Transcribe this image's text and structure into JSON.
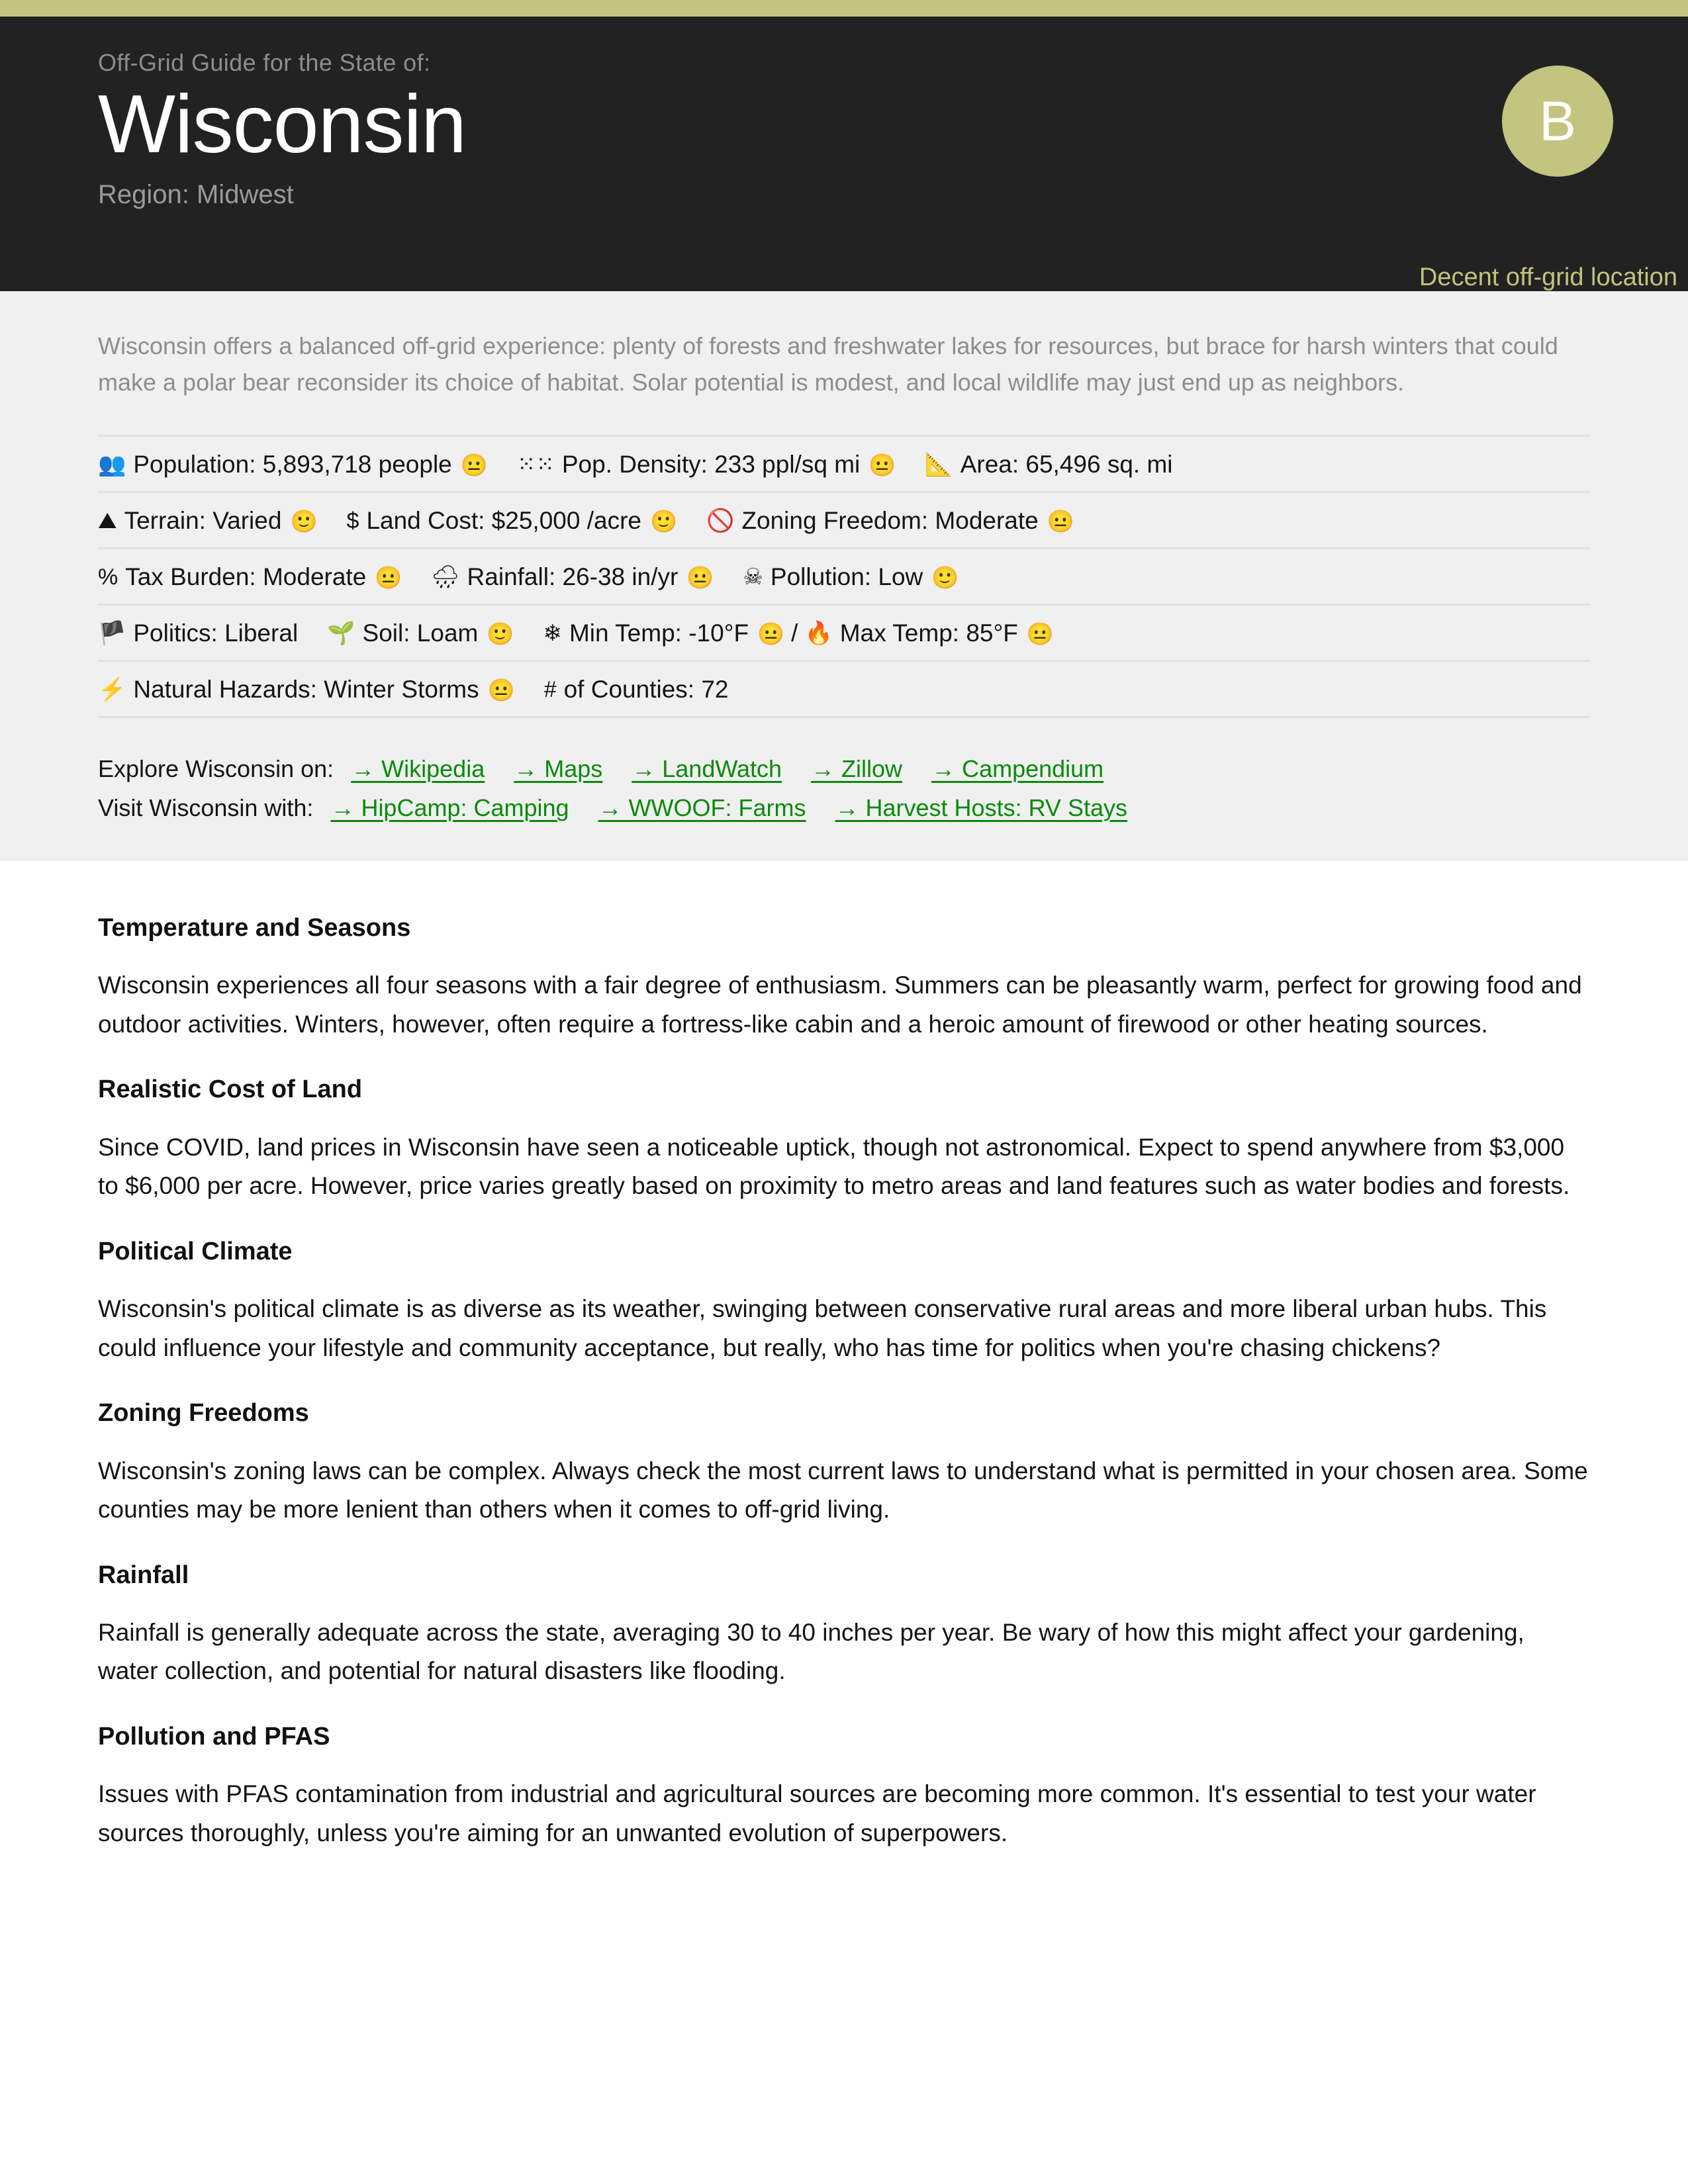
{
  "theme": {
    "accent": "#c2c47f",
    "header_bg": "#222222",
    "panel_bg": "#f0f0f0",
    "link_color": "#0a8a0a",
    "face_neutral_color": "#d9b118",
    "face_happy_color": "#4e9a4e"
  },
  "header": {
    "eyebrow": "Off-Grid Guide for the State of:",
    "title": "Wisconsin",
    "region": "Region: Midwest",
    "grade": "B",
    "grade_caption": "Decent off-grid location"
  },
  "summary": {
    "intro": "Wisconsin offers a balanced off-grid experience: plenty of forests and freshwater lakes for resources, but brace for harsh winters that could make a polar bear reconsider its choice of habitat. Solar potential is modest, and local wildlife may just end up as neighbors."
  },
  "stats": {
    "rows": [
      [
        {
          "icon": "people-icon",
          "glyph": "👥",
          "label": "Population: 5,893,718 people",
          "face": "neutral"
        },
        {
          "icon": "density-dots-icon",
          "glyph": "⁙⁙",
          "label": "Pop. Density: 233 ppl/sq mi",
          "face": "neutral"
        },
        {
          "icon": "ruler-icon",
          "glyph": "📐",
          "label": "Area: 65,496 sq. mi",
          "face": ""
        }
      ],
      [
        {
          "icon": "mountain-icon",
          "glyph": "⛰",
          "label": "Terrain: Varied",
          "face": "happy"
        },
        {
          "icon": "dollar-icon",
          "glyph": "$",
          "label": "Land Cost: $25,000 /acre",
          "face": "happy"
        },
        {
          "icon": "no-entry-icon",
          "glyph": "🚫",
          "label": "Zoning Freedom: Moderate",
          "face": "neutral"
        }
      ],
      [
        {
          "icon": "percent-icon",
          "glyph": "%",
          "label": "Tax Burden: Moderate",
          "face": "neutral"
        },
        {
          "icon": "rain-cloud-icon",
          "glyph": "🌧",
          "label": "Rainfall: 26-38 in/yr",
          "face": "neutral"
        },
        {
          "icon": "skull-crossbones-icon",
          "glyph": "☠",
          "label": "Pollution: Low",
          "face": "happy"
        }
      ],
      [
        {
          "icon": "flag-icon",
          "glyph": "🏴",
          "label": "Politics: Liberal",
          "face": ""
        },
        {
          "icon": "seedling-icon",
          "glyph": "🌱",
          "label": "Soil: Loam",
          "face": "happy"
        },
        {
          "icon": "snowflake-icon",
          "glyph": "❄",
          "label": "Min Temp: -10°F",
          "face": "neutral",
          "separator": "/"
        },
        {
          "icon": "flame-icon",
          "glyph": "🔥",
          "label": "Max Temp: 85°F",
          "face": "neutral"
        }
      ],
      [
        {
          "icon": "lightning-bolt-icon",
          "glyph": "⚡",
          "label": "Natural Hazards: Winter Storms",
          "face": "neutral"
        },
        {
          "icon": "hash-icon",
          "glyph": "#",
          "label": "of Counties: 72",
          "face": ""
        }
      ]
    ]
  },
  "links": {
    "explore_label": "Explore Wisconsin on:",
    "explore": [
      "→ Wikipedia",
      "→ Maps",
      "→ LandWatch",
      "→ Zillow",
      "→ Campendium"
    ],
    "visit_label": "Visit Wisconsin with:",
    "visit": [
      "→ HipCamp: Camping",
      "→ WWOOF: Farms",
      "→ Harvest Hosts: RV Stays"
    ]
  },
  "article": {
    "sections": [
      {
        "heading": "Temperature and Seasons",
        "body": "Wisconsin experiences all four seasons with a fair degree of enthusiasm. Summers can be pleasantly warm, perfect for growing food and outdoor activities. Winters, however, often require a fortress-like cabin and a heroic amount of firewood or other heating sources."
      },
      {
        "heading": "Realistic Cost of Land",
        "body": "Since COVID, land prices in Wisconsin have seen a noticeable uptick, though not astronomical. Expect to spend anywhere from $3,000 to $6,000 per acre. However, price varies greatly based on proximity to metro areas and land features such as water bodies and forests."
      },
      {
        "heading": "Political Climate",
        "body": "Wisconsin's political climate is as diverse as its weather, swinging between conservative rural areas and more liberal urban hubs. This could influence your lifestyle and community acceptance, but really, who has time for politics when you're chasing chickens?"
      },
      {
        "heading": "Zoning Freedoms",
        "body": "Wisconsin's zoning laws can be complex. Always check the most current laws to understand what is permitted in your chosen area. Some counties may be more lenient than others when it comes to off-grid living."
      },
      {
        "heading": "Rainfall",
        "body": "Rainfall is generally adequate across the state, averaging 30 to 40 inches per year. Be wary of how this might affect your gardening, water collection, and potential for natural disasters like flooding."
      },
      {
        "heading": "Pollution and PFAS",
        "body": "Issues with PFAS contamination from industrial and agricultural sources are becoming more common. It's essential to test your water sources thoroughly, unless you're aiming for an unwanted evolution of superpowers."
      }
    ]
  }
}
